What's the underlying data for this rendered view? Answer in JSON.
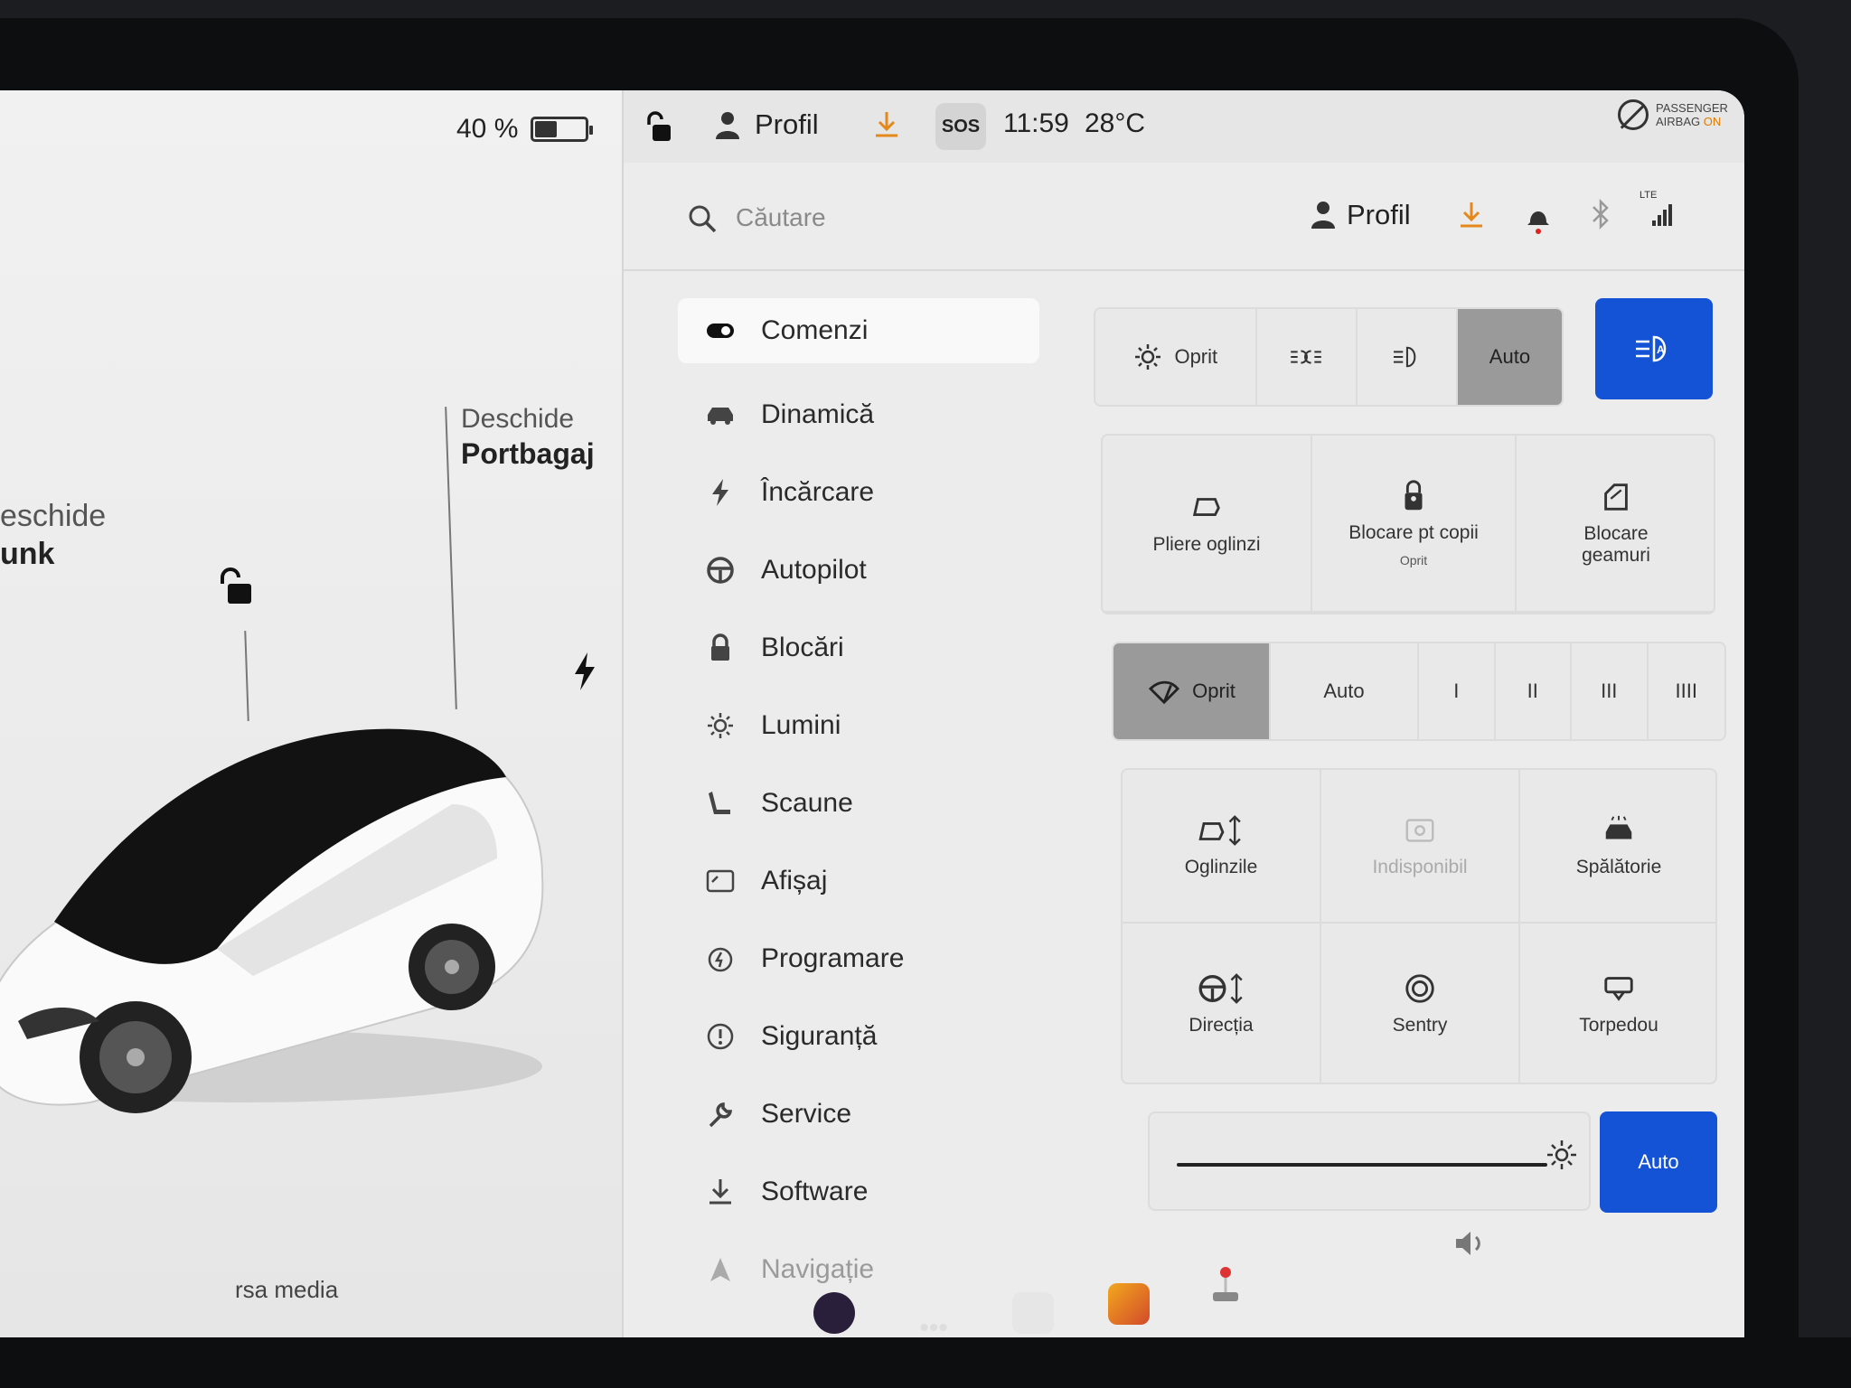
{
  "battery": {
    "percent_label": "40 %",
    "level": 0.4
  },
  "status": {
    "profile": "Profil",
    "sos": "SOS",
    "time": "11:59",
    "temp": "28°C",
    "airbag_line1": "PASSENGER",
    "airbag_line2": "AIRBAG",
    "airbag_state": "ON"
  },
  "car": {
    "frunk_line1": "eschide",
    "frunk_line2": "unk",
    "trunk_line1": "Deschide",
    "trunk_line2": "Portbagaj",
    "media": "rsa media"
  },
  "header": {
    "search_placeholder": "Căutare",
    "profile": "Profil",
    "lte": "LTE"
  },
  "nav": [
    {
      "label": "Comenzi",
      "icon": "toggle-icon"
    },
    {
      "label": "Dinamică",
      "icon": "car-icon"
    },
    {
      "label": "Încărcare",
      "icon": "bolt-icon"
    },
    {
      "label": "Autopilot",
      "icon": "steering-wheel-icon"
    },
    {
      "label": "Blocări",
      "icon": "lock-icon"
    },
    {
      "label": "Lumini",
      "icon": "sun-icon"
    },
    {
      "label": "Scaune",
      "icon": "seat-icon"
    },
    {
      "label": "Afișaj",
      "icon": "display-icon"
    },
    {
      "label": "Programare",
      "icon": "schedule-icon"
    },
    {
      "label": "Siguranță",
      "icon": "alert-icon"
    },
    {
      "label": "Service",
      "icon": "wrench-icon"
    },
    {
      "label": "Software",
      "icon": "download-icon"
    },
    {
      "label": "Navigație",
      "icon": "navigation-icon"
    }
  ],
  "lights": {
    "off": "Oprit",
    "auto": "Auto"
  },
  "tiles1": {
    "mirrors": "Pliere oglinzi",
    "child_lock": "Blocare pt copii",
    "child_lock_state": "Oprit",
    "window_lock_line1": "Blocare",
    "window_lock_line2": "geamuri"
  },
  "wipers": {
    "off": "Oprit",
    "auto": "Auto",
    "s1": "I",
    "s2": "II",
    "s3": "III",
    "s4": "IIII"
  },
  "tiles2": {
    "mirror_adjust": "Oglinzile",
    "unavailable": "Indisponibil",
    "car_wash": "Spălătorie",
    "steering": "Direcția",
    "sentry": "Sentry",
    "glovebox": "Torpedou"
  },
  "brightness": {
    "auto": "Auto"
  },
  "colors": {
    "accent_blue": "#1553d6",
    "download_orange": "#e5881c",
    "selected_gray": "#9a9a9a"
  }
}
